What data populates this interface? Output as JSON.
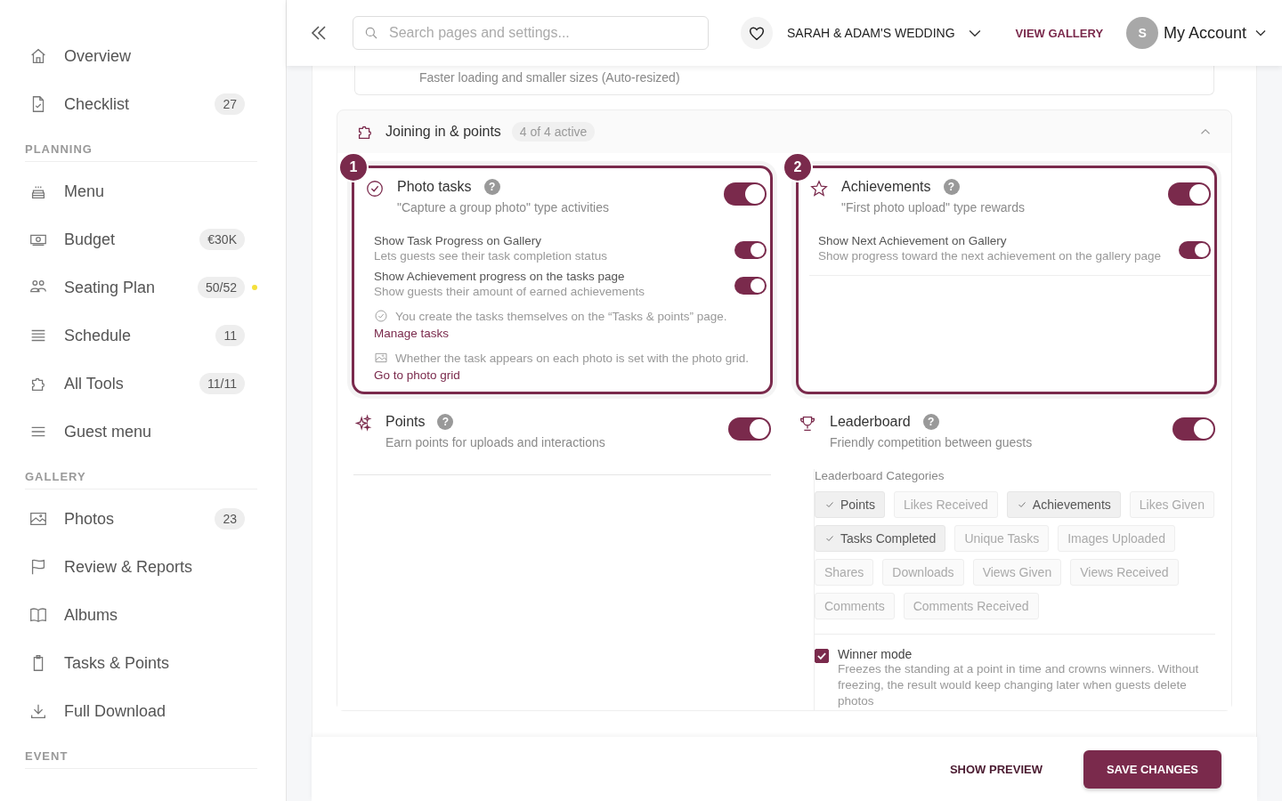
{
  "sidebar": {
    "groups": [
      {
        "items": [
          {
            "label": "Overview"
          },
          {
            "label": "Checklist",
            "badge": "27"
          }
        ]
      },
      {
        "heading": "PLANNING",
        "items": [
          {
            "label": "Menu"
          },
          {
            "label": "Budget",
            "badge": "€30K"
          },
          {
            "label": "Seating Plan",
            "badge": "50/52",
            "color": "#f5e03b"
          },
          {
            "label": "Schedule",
            "badge": "11"
          },
          {
            "label": "All Tools",
            "badge": "11/11"
          },
          {
            "label": "Guest menu"
          }
        ]
      },
      {
        "heading": "GALLERY",
        "items": [
          {
            "label": "Photos",
            "badge": "23"
          },
          {
            "label": "Review & Reports"
          },
          {
            "label": "Albums"
          },
          {
            "label": "Tasks & Points"
          },
          {
            "label": "Full Download"
          }
        ]
      },
      {
        "heading": "EVENT"
      }
    ]
  },
  "header": {
    "search": {
      "placeholder": "Search pages and settings..."
    },
    "event": "SARAH & ADAM'S WEDDING",
    "view_gallery": "VIEW GALLERY",
    "avatar": "S",
    "account": "My Account"
  },
  "top_card": {
    "text": "Faster loading and smaller sizes (Auto-resized)"
  },
  "section": {
    "title": "Joining in & points",
    "count": "4 of 4 active",
    "expanded": true,
    "features": [
      {
        "marker": "1",
        "title": "Photo tasks",
        "help": "?",
        "description": "\"Capture a group photo\" type activities",
        "on": true,
        "options": [
          {
            "title": "Show Task Progress on Gallery",
            "description": "Lets guests see their task completion status",
            "on": true
          },
          {
            "title": "Show Achievement progress on the tasks page",
            "description": "Show guests their amount of earned achievements",
            "on": true
          }
        ],
        "notes": [
          {
            "text": "You create the tasks themselves on the “Tasks & points” page.",
            "link": "Manage tasks"
          },
          {
            "text": "Whether the task appears on each photo is set with the photo grid.",
            "link": "Go to photo grid"
          }
        ]
      },
      {
        "marker": "2",
        "title": "Achievements",
        "help": "?",
        "description": "\"First photo upload\" type rewards",
        "on": true,
        "options": [
          {
            "title": "Show Next Achievement on Gallery",
            "description": "Show progress toward the next achievement on the gallery page",
            "on": true
          }
        ]
      },
      {
        "title": "Points",
        "help": "?",
        "description": "Earn points for uploads and interactions",
        "on": true
      },
      {
        "title": "Leaderboard",
        "help": "?",
        "description": "Friendly competition between guests",
        "on": true,
        "categories_label": "Leaderboard Categories",
        "categories": [
          {
            "label": "Points",
            "selected": true
          },
          {
            "label": "Likes Received",
            "selected": false
          },
          {
            "label": "Achievements",
            "selected": true
          },
          {
            "label": "Likes Given",
            "selected": false
          },
          {
            "label": "Tasks Completed",
            "selected": true
          },
          {
            "label": "Unique Tasks",
            "selected": false
          },
          {
            "label": "Images Uploaded",
            "selected": false
          },
          {
            "label": "Shares",
            "selected": false
          },
          {
            "label": "Downloads",
            "selected": false
          },
          {
            "label": "Views Given",
            "selected": false
          },
          {
            "label": "Views Received",
            "selected": false
          },
          {
            "label": "Comments",
            "selected": false
          },
          {
            "label": "Comments Received",
            "selected": false
          }
        ],
        "winner_mode": {
          "label": "Winner mode",
          "checked": true,
          "description": "Freezes the standing at a point in time and crowns winners. Without freezing, the result would keep changing later when guests delete photos"
        }
      }
    ]
  },
  "footer": {
    "preview": "SHOW PREVIEW",
    "save": "SAVE CHANGES"
  }
}
